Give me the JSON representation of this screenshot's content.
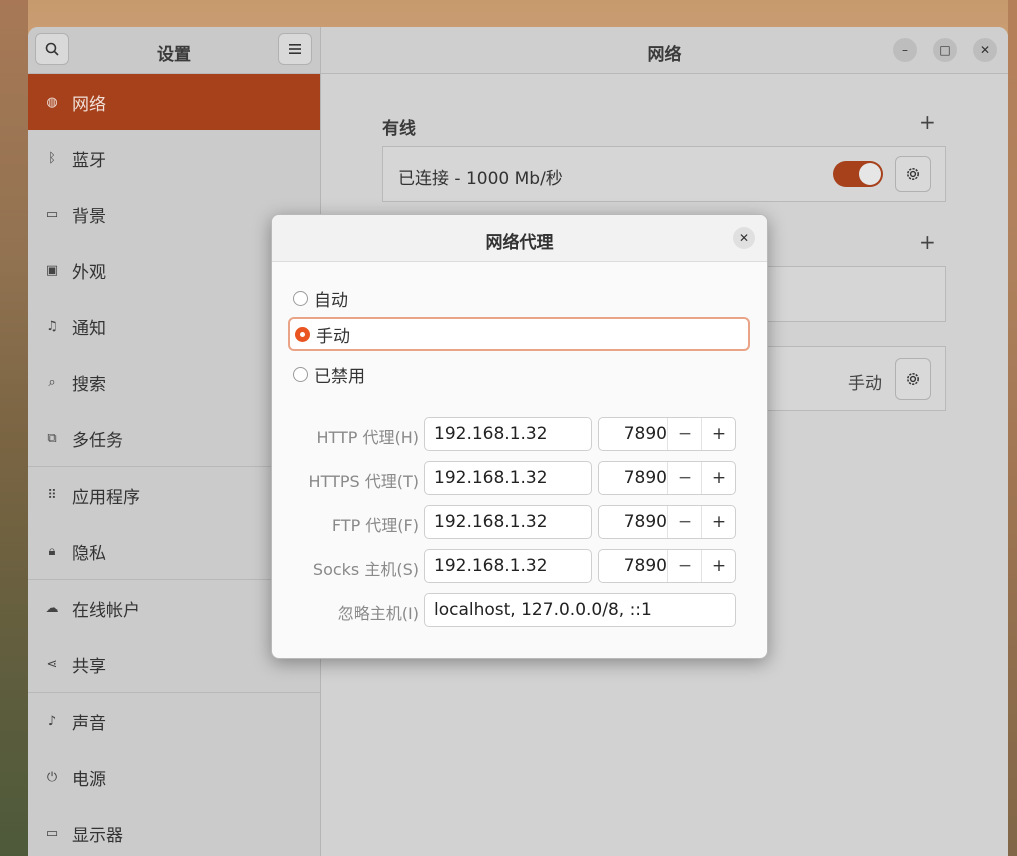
{
  "app": {
    "sidebar_title": "设置",
    "main_title": "网络"
  },
  "sidebar": {
    "items": [
      {
        "label": "网络",
        "icon": "network-icon"
      },
      {
        "label": "蓝牙",
        "icon": "bluetooth-icon"
      },
      {
        "label": "背景",
        "icon": "background-icon"
      },
      {
        "label": "外观",
        "icon": "appearance-icon"
      },
      {
        "label": "通知",
        "icon": "bell-icon"
      },
      {
        "label": "搜索",
        "icon": "search-icon"
      },
      {
        "label": "多任务",
        "icon": "multitasking-icon"
      },
      {
        "label": "应用程序",
        "icon": "apps-grid-icon"
      },
      {
        "label": "隐私",
        "icon": "lock-icon"
      },
      {
        "label": "在线帐户",
        "icon": "cloud-icon"
      },
      {
        "label": "共享",
        "icon": "share-icon"
      },
      {
        "label": "声音",
        "icon": "music-note-icon"
      },
      {
        "label": "电源",
        "icon": "power-icon"
      },
      {
        "label": "显示器",
        "icon": "display-icon"
      }
    ]
  },
  "main": {
    "wired_label": "有线",
    "wired_status": "已连接 - 1000 Mb/秒",
    "proxy_value": "手动"
  },
  "dialog": {
    "title": "网络代理",
    "options": [
      "自动",
      "手动",
      "已禁用"
    ],
    "selected": "手动",
    "rows": [
      {
        "label": "HTTP 代理(H)",
        "host": "192.168.1.32",
        "port": "7890"
      },
      {
        "label": "HTTPS 代理(T)",
        "host": "192.168.1.32",
        "port": "7890"
      },
      {
        "label": "FTP 代理(F)",
        "host": "192.168.1.32",
        "port": "7890"
      },
      {
        "label": "Socks 主机(S)",
        "host": "192.168.1.32",
        "port": "7890"
      }
    ],
    "ignore_label": "忽略主机(I)",
    "ignore_value": "localhost, 127.0.0.0/8, ::1"
  },
  "colors": {
    "accent": "#e95420",
    "sidebar_active": "#a6411c"
  }
}
